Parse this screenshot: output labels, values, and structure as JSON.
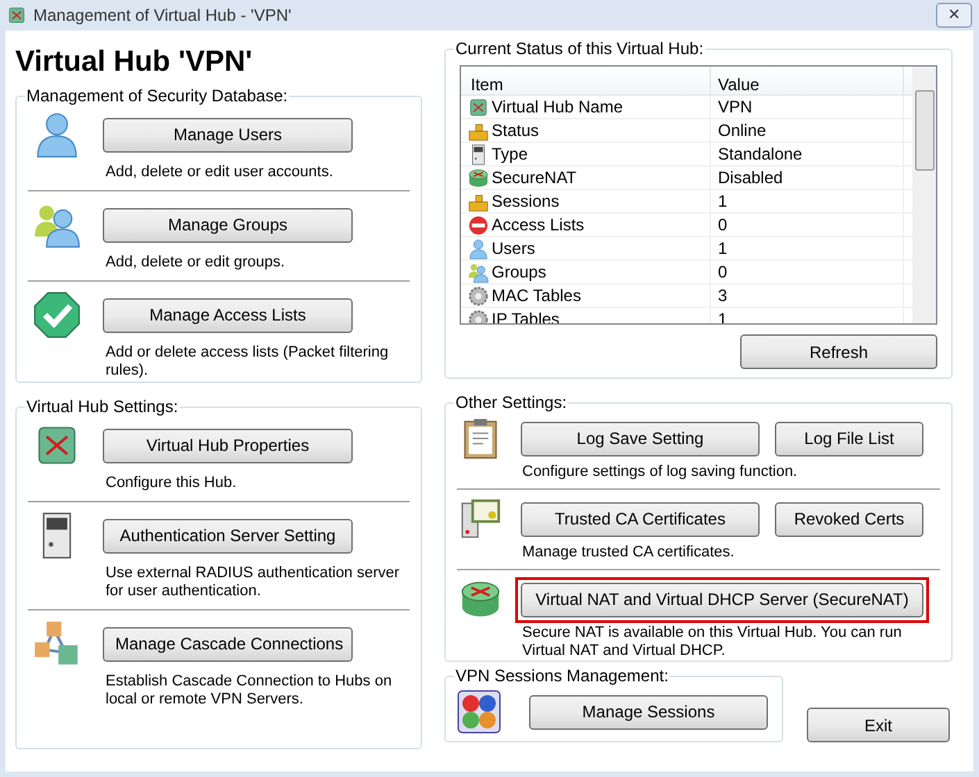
{
  "window": {
    "title": "Management of Virtual Hub - 'VPN'",
    "close": "✕"
  },
  "heading": "Virtual Hub 'VPN'",
  "security_database": {
    "title": "Management of Security Database:",
    "sections": [
      {
        "button": "Manage Users",
        "description": "Add, delete or edit user accounts."
      },
      {
        "button": "Manage Groups",
        "description": "Add, delete or edit groups."
      },
      {
        "button": "Manage Access Lists",
        "description": "Add or delete access lists (Packet filtering rules)."
      }
    ]
  },
  "hub_settings": {
    "title": "Virtual Hub Settings:",
    "sections": [
      {
        "button": "Virtual Hub Properties",
        "description": "Configure this Hub."
      },
      {
        "button": "Authentication Server Setting",
        "description": "Use external RADIUS authentication server for user authentication."
      },
      {
        "button": "Manage Cascade Connections",
        "description": "Establish Cascade Connection to Hubs on local or remote VPN Servers."
      }
    ]
  },
  "status": {
    "title": "Current Status of this Virtual Hub:",
    "columns": [
      "Item",
      "Value"
    ],
    "rows": [
      {
        "item": "Virtual Hub Name",
        "value": "VPN"
      },
      {
        "item": "Status",
        "value": "Online"
      },
      {
        "item": "Type",
        "value": "Standalone"
      },
      {
        "item": "SecureNAT",
        "value": "Disabled"
      },
      {
        "item": "Sessions",
        "value": "1"
      },
      {
        "item": "Access Lists",
        "value": "0"
      },
      {
        "item": "Users",
        "value": "1"
      },
      {
        "item": "Groups",
        "value": "0"
      },
      {
        "item": "MAC Tables",
        "value": "3"
      },
      {
        "item": "IP Tables",
        "value": "1"
      }
    ],
    "refresh_button": "Refresh"
  },
  "other_settings": {
    "title": "Other Settings:",
    "sections": [
      {
        "buttons": [
          {
            "label": "Log Save Setting",
            "highlighted": false
          },
          {
            "label": "Log File List",
            "highlighted": false
          }
        ],
        "description": "Configure settings of log saving function."
      },
      {
        "buttons": [
          {
            "label": "Trusted CA Certificates",
            "highlighted": false
          },
          {
            "label": "Revoked Certs",
            "highlighted": false
          }
        ],
        "description": "Manage trusted CA certificates."
      },
      {
        "buttons": [
          {
            "label": "Virtual NAT and Virtual DHCP Server (SecureNAT)",
            "highlighted": true
          }
        ],
        "description": "Secure NAT is available on this Virtual Hub. You can run Virtual NAT and Virtual DHCP."
      }
    ]
  },
  "sessions": {
    "title": "VPN Sessions Management:",
    "button": "Manage Sessions"
  },
  "exit_button": "Exit"
}
